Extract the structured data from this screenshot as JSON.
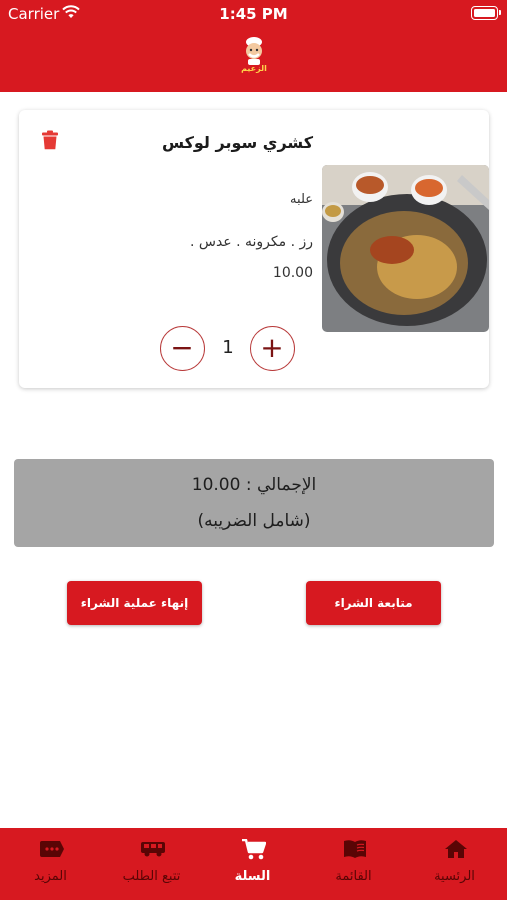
{
  "status_bar": {
    "carrier": "Carrier",
    "time": "1:45 PM"
  },
  "header": {
    "logo_text": "الزعيم"
  },
  "cart_item": {
    "name": "كشري سوبر لوكس",
    "size": "علبه",
    "description": "رز . مكرونه . عدس .",
    "price": "10.00",
    "quantity": "1",
    "minus_symbol": "−",
    "plus_symbol": "+"
  },
  "summary": {
    "total_label": "الإجمالي : 10.00",
    "tax_note": "(شامل الضريبه)"
  },
  "actions": {
    "finish_label": "إنهاء عملية الشراء",
    "continue_label": "متابعة الشراء"
  },
  "tabs": [
    {
      "label": "المزيد",
      "icon": "more-tag-icon"
    },
    {
      "label": "تتبع الطلب",
      "icon": "delivery-truck-icon"
    },
    {
      "label": "السلة",
      "icon": "cart-icon",
      "active": true
    },
    {
      "label": "القائمة",
      "icon": "menu-book-icon"
    },
    {
      "label": "الرئسية",
      "icon": "home-icon"
    }
  ],
  "colors": {
    "brand_red": "#d71920",
    "total_bg": "#a5a5a5",
    "inactive_tab": "#5a0505"
  }
}
